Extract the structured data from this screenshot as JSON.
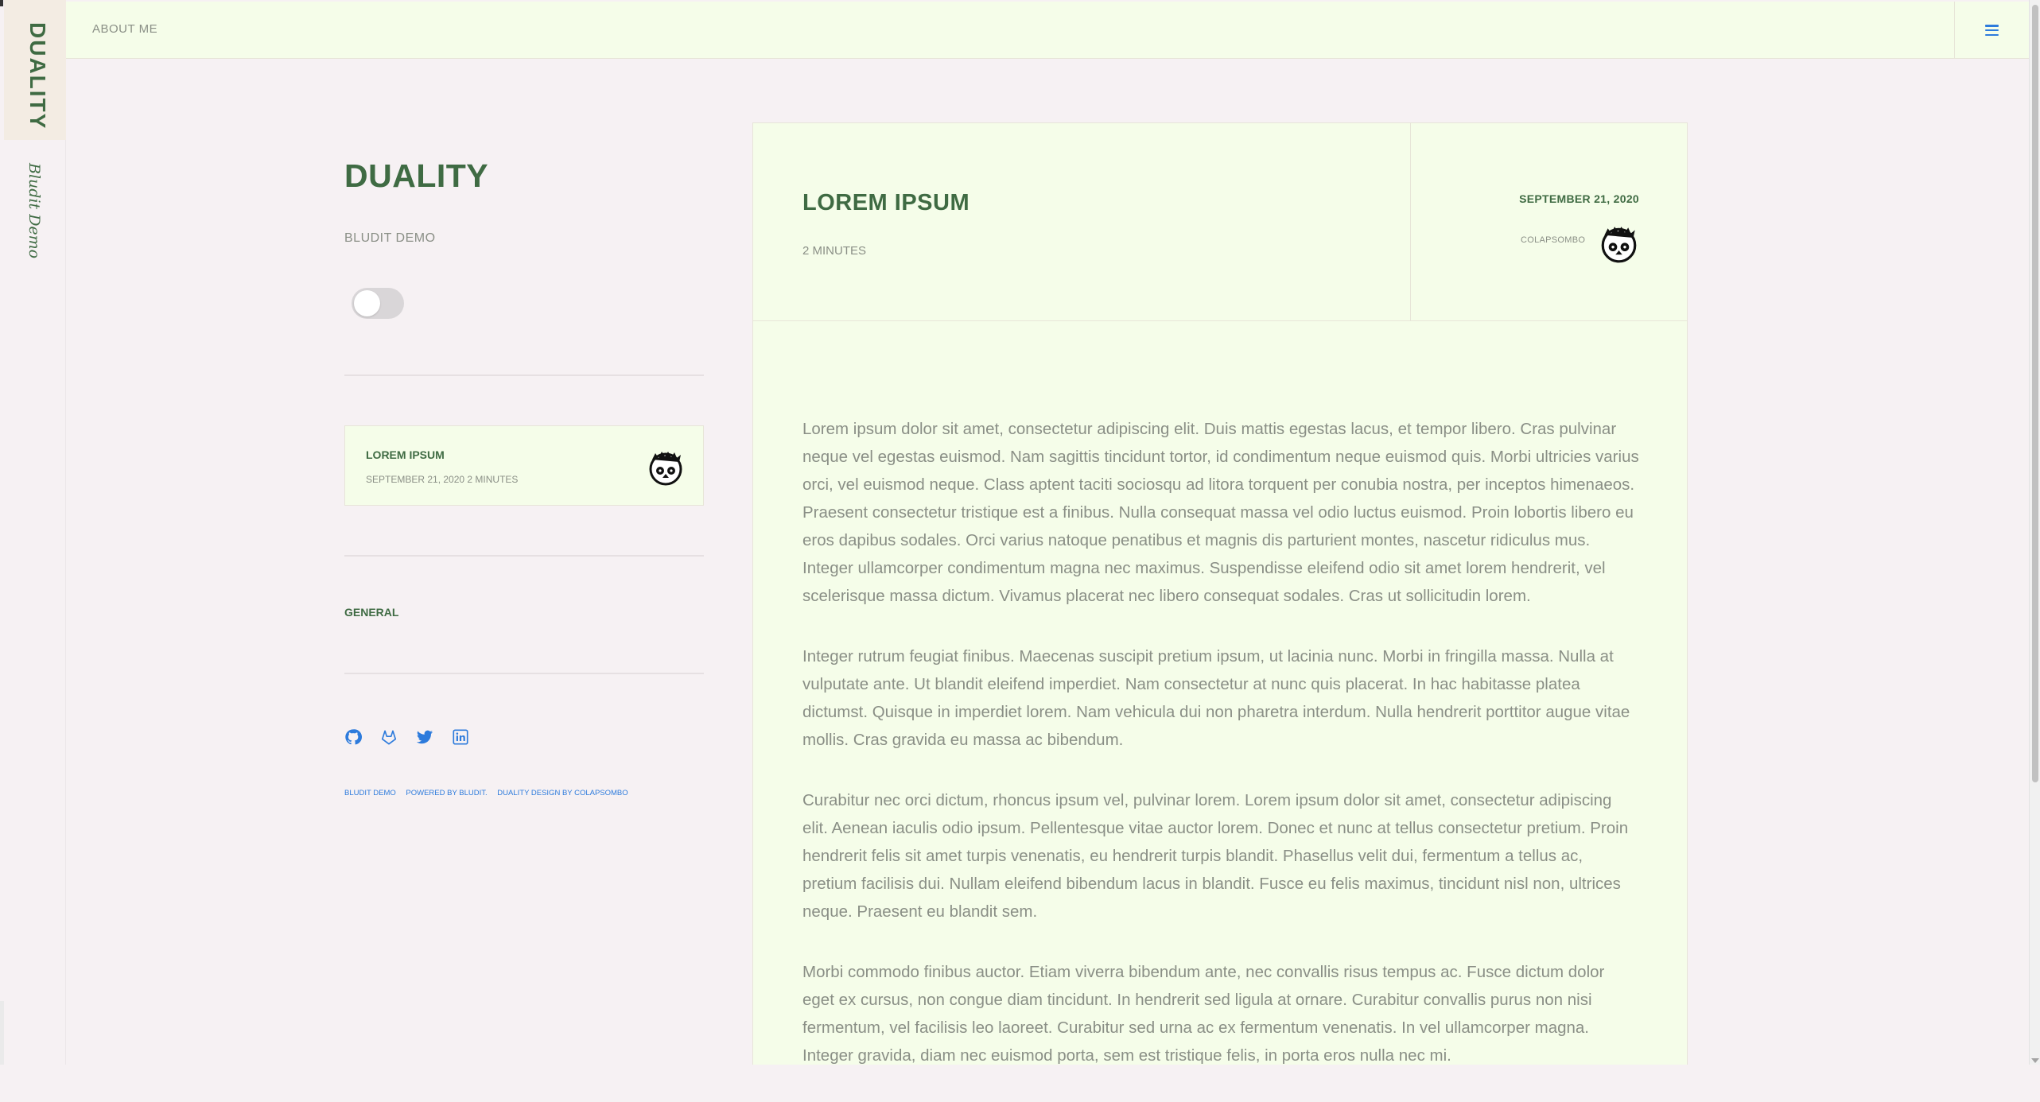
{
  "nav": {
    "about_label": "ABOUT ME",
    "menu_icon": "hamburger-icon"
  },
  "rail": {
    "brand": "DUALITY",
    "subtitle": "Bludit Demo"
  },
  "sidebar": {
    "title": "DUALITY",
    "description": "BLUDIT DEMO",
    "theme_toggle": {
      "state": "off"
    },
    "recent_post": {
      "title": "LOREM IPSUM",
      "meta": "SEPTEMBER 21, 2020 2 MINUTES",
      "avatar_icon": "panda-avatar-icon"
    },
    "category": "GENERAL",
    "social_icons": [
      "github-icon",
      "gitlab-icon",
      "twitter-icon",
      "linkedin-icon"
    ],
    "footer": {
      "site_link": "BLUDIT DEMO",
      "powered_by": "POWERED BY BLUDIT.",
      "design_credit": "DUALITY DESIGN BY COLAPSOMBO"
    }
  },
  "article": {
    "title": "LOREM IPSUM",
    "read_time": "2 MINUTES",
    "date": "SEPTEMBER 21, 2020",
    "author": "COLAPSOMBO",
    "paragraphs": [
      "Lorem ipsum dolor sit amet, consectetur adipiscing elit. Duis mattis egestas lacus, et tempor libero. Cras pulvinar neque vel egestas euismod. Nam sagittis tincidunt tortor, id condimentum neque euismod quis. Morbi ultricies varius orci, vel euismod neque. Class aptent taciti sociosqu ad litora torquent per conubia nostra, per inceptos himenaeos. Praesent consectetur tristique est a finibus. Nulla consequat massa vel odio luctus euismod. Proin lobortis libero eu eros dapibus sodales. Orci varius natoque penatibus et magnis dis parturient montes, nascetur ridiculus mus. Integer ullamcorper condimentum magna nec maximus. Suspendisse eleifend odio sit amet lorem hendrerit, vel scelerisque massa dictum. Vivamus placerat nec libero consequat sodales. Cras ut sollicitudin lorem.",
      "Integer rutrum feugiat finibus. Maecenas suscipit pretium ipsum, ut lacinia nunc. Morbi in fringilla massa. Nulla at vulputate ante. Ut blandit eleifend imperdiet. Nam consectetur at nunc quis placerat. In hac habitasse platea dictumst. Quisque in imperdiet lorem. Nam vehicula dui non pharetra interdum. Nulla hendrerit porttitor augue vitae mollis. Cras gravida eu massa ac bibendum.",
      "Curabitur nec orci dictum, rhoncus ipsum vel, pulvinar lorem. Lorem ipsum dolor sit amet, consectetur adipiscing elit. Aenean iaculis odio ipsum. Pellentesque vitae auctor lorem. Donec et nunc at tellus consectetur pretium. Proin hendrerit felis sit amet turpis venenatis, eu hendrerit turpis blandit. Phasellus velit dui, fermentum a tellus ac, pretium facilisis dui. Nullam eleifend bibendum lacus in blandit. Fusce eu felis maximus, tincidunt nisl non, ultrices neque. Praesent eu blandit sem.",
      "Morbi commodo finibus auctor. Etiam viverra bibendum ante, nec convallis risus tempus ac. Fusce dictum dolor eget ex cursus, non congue diam tincidunt. In hendrerit sed ligula at ornare. Curabitur convallis purus non nisi fermentum, vel facilisis leo laoreet. Curabitur sed urna ac ex fermentum venenatis. In vel ullamcorper magna. Integer gravida, diam nec euismod porta, sem est tristique felis, in porta eros nulla nec mi."
    ]
  },
  "colors": {
    "accent_green": "#3f6b43",
    "link_blue": "#2d7bdc",
    "card_bg": "#f5fde9",
    "page_bg": "#f6f1f3",
    "muted_text": "#8a8f86"
  }
}
